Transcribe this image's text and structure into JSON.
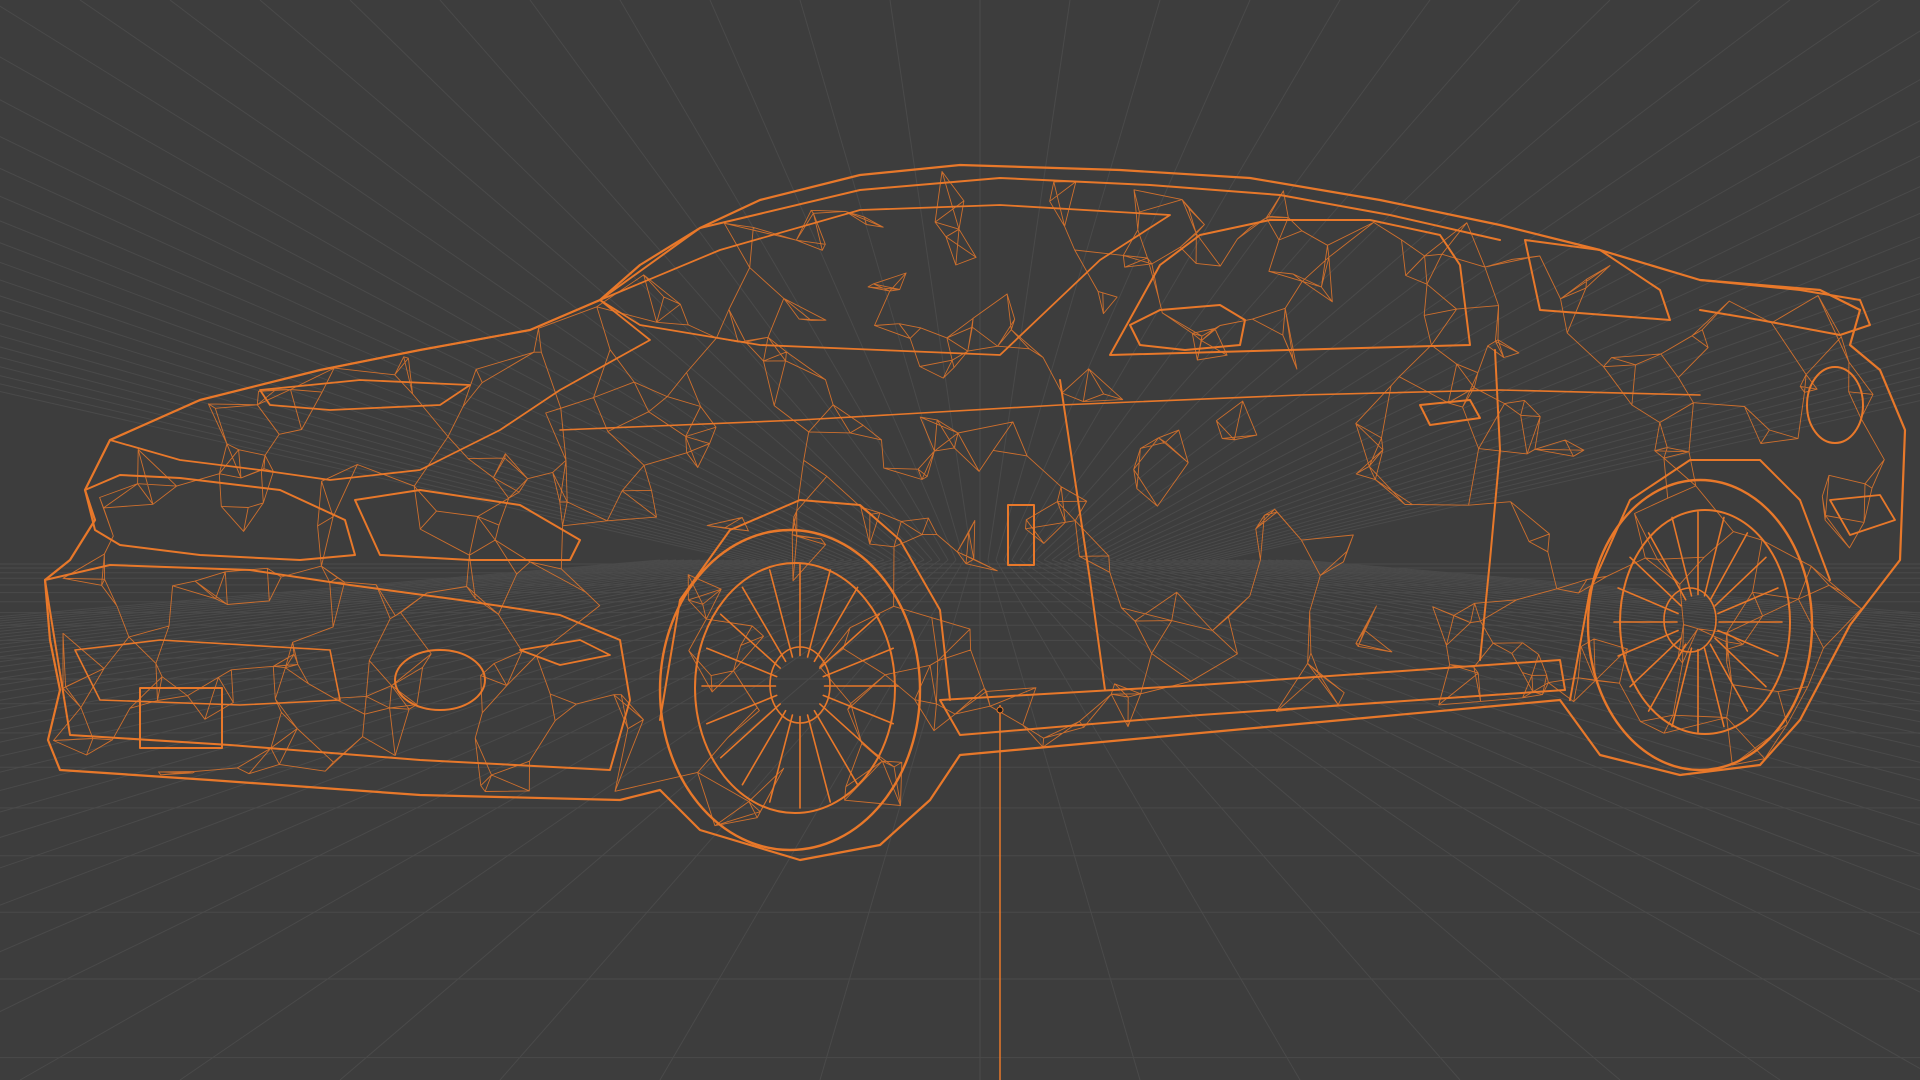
{
  "viewport": {
    "mode": "wireframe",
    "object": "car-model",
    "colors": {
      "background": "#3d3d3d",
      "grid": "#4a4a4a",
      "wire": "#e8782a"
    }
  }
}
